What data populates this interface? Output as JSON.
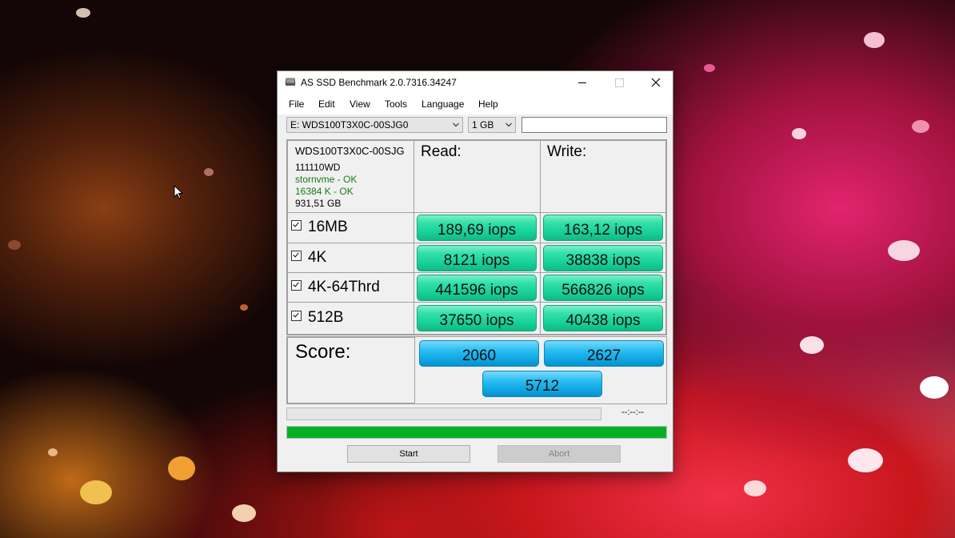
{
  "window": {
    "title": "AS SSD Benchmark 2.0.7316.34247"
  },
  "menu": [
    "File",
    "Edit",
    "View",
    "Tools",
    "Language",
    "Help"
  ],
  "drive_select": {
    "value": "E: WDS100T3X0C-00SJG0"
  },
  "size_select": {
    "value": "1 GB"
  },
  "text_field": {
    "value": ""
  },
  "info": {
    "model": "WDS100T3X0C-00SJG",
    "firmware": "111110WD",
    "driver": "stornvme - OK",
    "alignment": "16384 K - OK",
    "capacity": "931,51 GB"
  },
  "headers": {
    "read": "Read:",
    "write": "Write:"
  },
  "tests": [
    {
      "label": "16MB",
      "checked": true,
      "read": "189,69 iops",
      "write": "163,12 iops"
    },
    {
      "label": "4K",
      "checked": true,
      "read": "8121 iops",
      "write": "38838 iops"
    },
    {
      "label": "4K-64Thrd",
      "checked": true,
      "read": "441596 iops",
      "write": "566826 iops"
    },
    {
      "label": "512B",
      "checked": true,
      "read": "37650 iops",
      "write": "40438 iops"
    }
  ],
  "score": {
    "label": "Score:",
    "read": "2060",
    "write": "2627",
    "total": "5712"
  },
  "progress": {
    "small_fraction": 0.0,
    "big_fraction": 1.0,
    "time": "--:--:--"
  },
  "buttons": {
    "start": "Start",
    "abort": "Abort"
  },
  "colors": {
    "result_green": "#18d39a",
    "score_blue": "#0fa9e4",
    "progress_green": "#06b025",
    "ok_text": "#1b7a1b"
  },
  "icons": {
    "app": "drive-icon",
    "cursor": "mouse-pointer-icon"
  }
}
